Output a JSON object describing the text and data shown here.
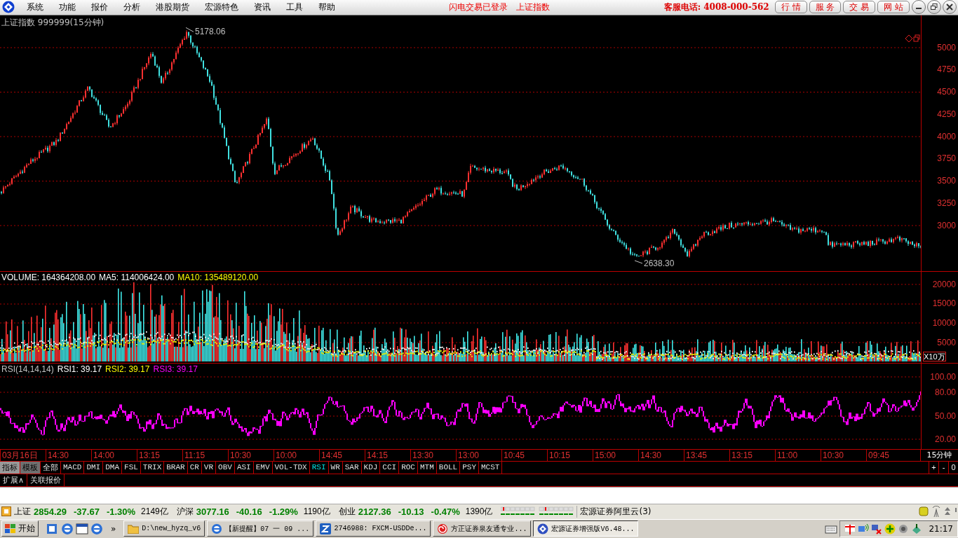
{
  "menu": {
    "items": [
      "系统",
      "功能",
      "报价",
      "分析",
      "港股期货",
      "宏源特色",
      "资讯",
      "工具",
      "帮助"
    ],
    "status": [
      "闪电交易已登录",
      "上证指数"
    ],
    "hotline": "客服电话: 4008-000-562",
    "buttons": [
      "行 情",
      "服 务",
      "交 易",
      "网 站"
    ]
  },
  "chart": {
    "title": "上证指数 999999(15分钟)",
    "price_axis": [
      "5000",
      "4750",
      "4500",
      "4250",
      "4000",
      "3750",
      "3500",
      "3250",
      "3000"
    ],
    "high_label": "5178.06",
    "low_label": "2638.30"
  },
  "volume": {
    "legend": [
      {
        "text": "VOLUME: 164364208.00",
        "color": "#ffffff"
      },
      {
        "text": "MA5: 114006424.00",
        "color": "#ffffff"
      },
      {
        "text": "MA10: 135489120.00",
        "color": "#ffff00"
      }
    ],
    "axis": [
      "20000",
      "15000",
      "10000",
      "5000"
    ],
    "unit": "X10万"
  },
  "rsi": {
    "legend": [
      {
        "text": "RSI(14,14,14)",
        "color": "#c0c0c0"
      },
      {
        "text": "RSI1: 39.17",
        "color": "#ffffff"
      },
      {
        "text": "RSI2: 39.17",
        "color": "#ffff00"
      },
      {
        "text": "RSI3: 39.17",
        "color": "#ff00ff"
      }
    ],
    "axis": [
      "100.00",
      "80.00",
      "50.00",
      "20.00"
    ]
  },
  "time_axis": {
    "labels": [
      "03月16日",
      "14:30",
      "14:00",
      "13:15",
      "11:15",
      "10:30",
      "10:00",
      "14:45",
      "14:15",
      "13:30",
      "13:00",
      "10:45",
      "10:15",
      "15:00",
      "14:30",
      "13:45",
      "13:15",
      "11:00",
      "10:30",
      "09:45"
    ],
    "period": "15分钟"
  },
  "indicator_tabs": [
    {
      "label": "指标",
      "kind": "category",
      "selected": true
    },
    {
      "label": "模板",
      "kind": "category",
      "selected": false
    },
    {
      "label": "全部",
      "kind": "indicator",
      "selected": false
    },
    {
      "label": "MACD",
      "kind": "indicator",
      "selected": false
    },
    {
      "label": "DMI",
      "kind": "indicator",
      "selected": false
    },
    {
      "label": "DMA",
      "kind": "indicator",
      "selected": false
    },
    {
      "label": "FSL",
      "kind": "indicator",
      "selected": false
    },
    {
      "label": "TRIX",
      "kind": "indicator",
      "selected": false
    },
    {
      "label": "BRAR",
      "kind": "indicator",
      "selected": false
    },
    {
      "label": "CR",
      "kind": "indicator",
      "selected": false
    },
    {
      "label": "VR",
      "kind": "indicator",
      "selected": false
    },
    {
      "label": "OBV",
      "kind": "indicator",
      "selected": false
    },
    {
      "label": "ASI",
      "kind": "indicator",
      "selected": false
    },
    {
      "label": "EMV",
      "kind": "indicator",
      "selected": false
    },
    {
      "label": "VOL-TDX",
      "kind": "indicator",
      "selected": false
    },
    {
      "label": "RSI",
      "kind": "indicator",
      "selected": true
    },
    {
      "label": "WR",
      "kind": "indicator",
      "selected": false
    },
    {
      "label": "SAR",
      "kind": "indicator",
      "selected": false
    },
    {
      "label": "KDJ",
      "kind": "indicator",
      "selected": false
    },
    {
      "label": "CCI",
      "kind": "indicator",
      "selected": false
    },
    {
      "label": "ROC",
      "kind": "indicator",
      "selected": false
    },
    {
      "label": "MTM",
      "kind": "indicator",
      "selected": false
    },
    {
      "label": "BOLL",
      "kind": "indicator",
      "selected": false
    },
    {
      "label": "PSY",
      "kind": "indicator",
      "selected": false
    },
    {
      "label": "MCST",
      "kind": "indicator",
      "selected": false
    }
  ],
  "zoom_buttons": [
    "+",
    "-",
    "0"
  ],
  "sub_tabs": [
    "扩展∧",
    "关联报价"
  ],
  "status_bar": {
    "indices": [
      {
        "name": "上证",
        "value": "2854.29",
        "change": "-37.67",
        "pct": "-1.30%",
        "amount": "2149亿"
      },
      {
        "name": "沪深",
        "value": "3077.16",
        "change": "-40.16",
        "pct": "-1.29%",
        "amount": "1190亿"
      },
      {
        "name": "创业",
        "value": "2127.36",
        "change": "-10.13",
        "pct": "-0.47%",
        "amount": "1390亿"
      }
    ],
    "server": "宏源证券阿里云(3)"
  },
  "taskbar": {
    "start": "开始",
    "more": "»",
    "tasks": [
      {
        "label": "D:\\new_hyzq_v6",
        "kind": "folder",
        "selected": false
      },
      {
        "label": "【新提醒】07 一 09 ...",
        "kind": "browser",
        "selected": false
      },
      {
        "label": "2746988: FXCM-USDDe...",
        "kind": "app-z",
        "selected": false
      },
      {
        "label": "方正证券泉友通专业...",
        "kind": "app-swirl",
        "selected": false
      },
      {
        "label": "宏源证券增强版V6.48...",
        "kind": "app-diamond",
        "selected": true
      }
    ],
    "clock": "21:17"
  }
}
